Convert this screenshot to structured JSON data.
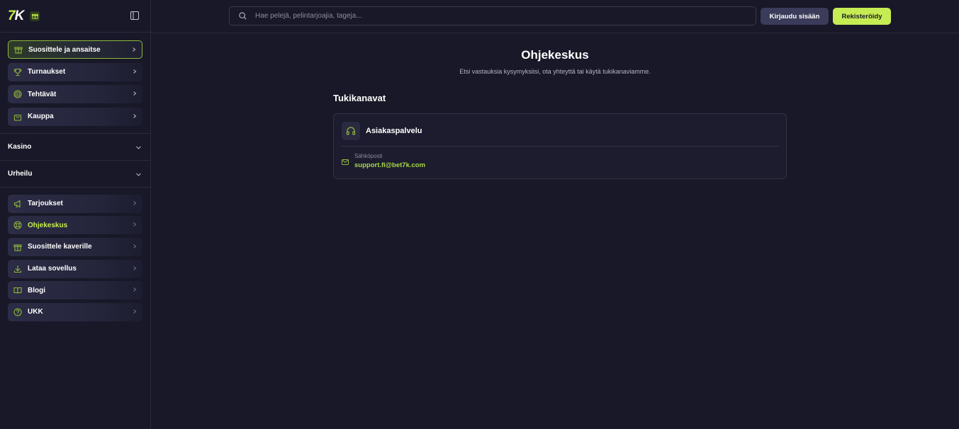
{
  "brand": {
    "logo_seven": "7",
    "logo_k": "K",
    "accent": "#c6f04a"
  },
  "sidebar": {
    "top_items": [
      {
        "label": "Suosittele ja ansaitse",
        "icon": "gift-icon"
      },
      {
        "label": "Turnaukset",
        "icon": "trophy-icon"
      },
      {
        "label": "Tehtävät",
        "icon": "target-icon"
      },
      {
        "label": "Kauppa",
        "icon": "shopping-bag-icon"
      }
    ],
    "sections": [
      {
        "label": "Kasino"
      },
      {
        "label": "Urheilu"
      }
    ],
    "bottom_items": [
      {
        "label": "Tarjoukset",
        "icon": "megaphone-icon"
      },
      {
        "label": "Ohjekeskus",
        "icon": "lifebuoy-icon",
        "active": true
      },
      {
        "label": "Suosittele kaverille",
        "icon": "gift-icon"
      },
      {
        "label": "Lataa sovellus",
        "icon": "download-icon"
      },
      {
        "label": "Blogi",
        "icon": "book-icon"
      },
      {
        "label": "UKK",
        "icon": "question-icon"
      }
    ]
  },
  "header": {
    "search_placeholder": "Hae pelejä, pelintarjoajia, tageja...",
    "login_label": "Kirjaudu sisään",
    "register_label": "Rekisteröidy"
  },
  "main": {
    "title": "Ohjekeskus",
    "subtitle": "Etsi vastauksia kysymyksiisi, ota yhteyttä tai käytä tukikanaviamme.",
    "section_title": "Tukikanavat",
    "card": {
      "title": "Asiakaspalvelu",
      "email_label": "Sähköposti",
      "email_value": "support.fi@bet7k.com"
    }
  }
}
